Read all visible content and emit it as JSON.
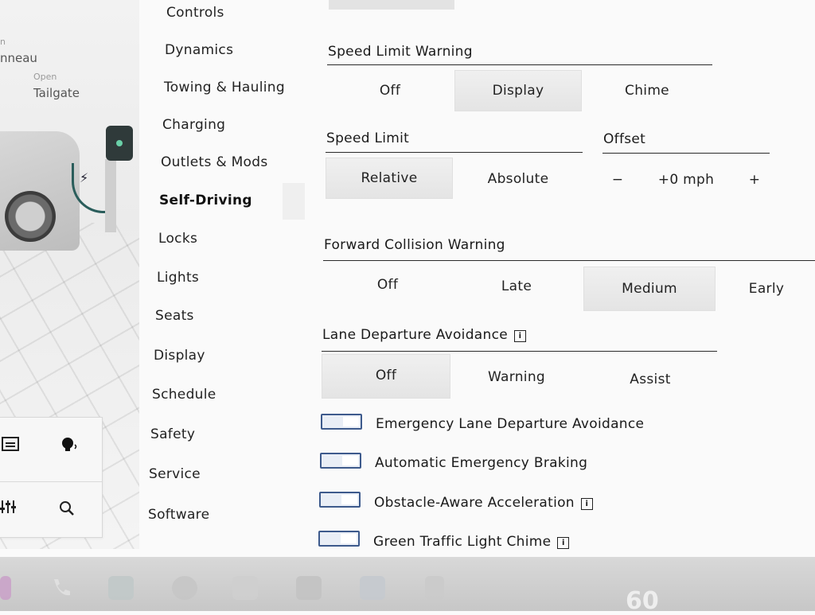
{
  "car_view": {
    "tonneau_label_small": "n",
    "tonneau_label": "nneau",
    "tailgate_state": "Open",
    "tailgate_label": "Tailgate"
  },
  "menu": {
    "items": [
      {
        "label": "Controls"
      },
      {
        "label": "Dynamics"
      },
      {
        "label": "Towing & Hauling"
      },
      {
        "label": "Charging"
      },
      {
        "label": "Outlets & Mods"
      },
      {
        "label": "Self-Driving"
      },
      {
        "label": "Locks"
      },
      {
        "label": "Lights"
      },
      {
        "label": "Seats"
      },
      {
        "label": "Display"
      },
      {
        "label": "Schedule"
      },
      {
        "label": "Safety"
      },
      {
        "label": "Service"
      },
      {
        "label": "Software"
      }
    ],
    "active": "Self-Driving"
  },
  "settings": {
    "speed_limit_warning": {
      "title": "Speed Limit Warning",
      "options": [
        "Off",
        "Display",
        "Chime"
      ],
      "selected": "Display"
    },
    "speed_limit": {
      "title": "Speed Limit",
      "options": [
        "Relative",
        "Absolute"
      ],
      "selected": "Relative"
    },
    "offset": {
      "title": "Offset",
      "minus": "−",
      "value": "+0 mph",
      "plus": "+"
    },
    "forward_collision_warning": {
      "title": "Forward Collision Warning",
      "options": [
        "Off",
        "Late",
        "Medium",
        "Early"
      ],
      "selected": "Medium"
    },
    "lane_departure_avoidance": {
      "title": "Lane Departure Avoidance",
      "options": [
        "Off",
        "Warning",
        "Assist"
      ],
      "selected": "Off"
    },
    "toggles": [
      {
        "label": "Emergency Lane Departure Avoidance",
        "info": false
      },
      {
        "label": "Automatic Emergency Braking",
        "info": false
      },
      {
        "label": "Obstacle-Aware Acceleration",
        "info": true
      },
      {
        "label": "Green Traffic Light Chime",
        "info": true
      }
    ]
  },
  "taskbar": {
    "speed": "60"
  },
  "colors": {
    "toggle_border": "#3d5a8c",
    "selected_bg": "#e6e6e6"
  }
}
